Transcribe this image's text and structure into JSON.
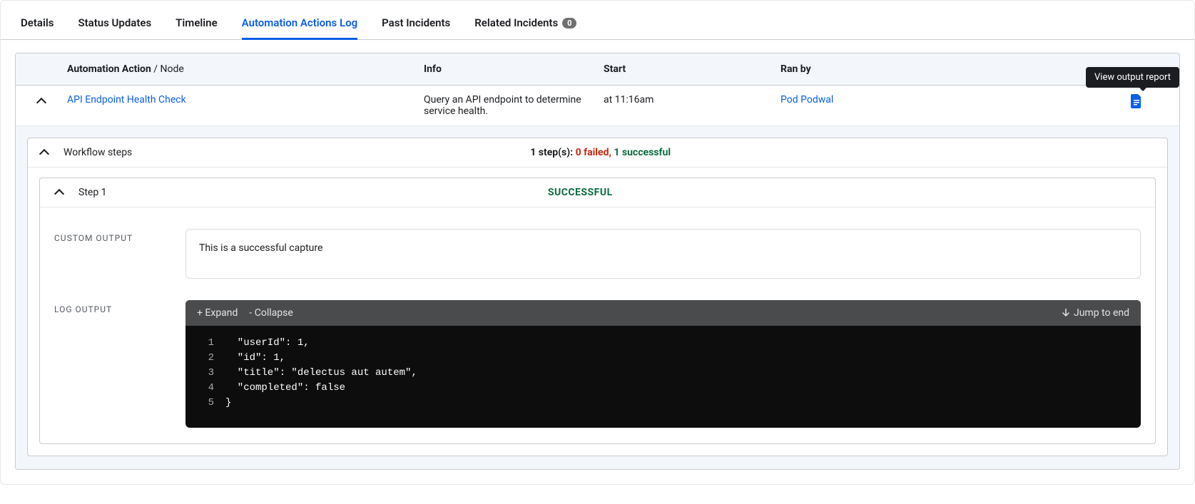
{
  "tabs": {
    "details": "Details",
    "status_updates": "Status Updates",
    "timeline": "Timeline",
    "automation_log": "Automation Actions Log",
    "past_incidents": "Past Incidents",
    "related_incidents": "Related Incidents",
    "related_incidents_count": "0"
  },
  "columns": {
    "action_main": "Automation Action",
    "action_sep": " / ",
    "action_sub": "Node",
    "info": "Info",
    "start": "Start",
    "ran_by": "Ran by"
  },
  "row": {
    "action_name": "API Endpoint Health Check",
    "info": "Query an API endpoint to determine service health.",
    "start": "at 11:16am",
    "ran_by": "Pod Podwal",
    "tooltip": "View output report"
  },
  "workflow": {
    "title": "Workflow steps",
    "summary_count": "1 step(s):",
    "failed_n": "0",
    "failed_label": " failed,",
    "success_n": "1",
    "success_label": " successful"
  },
  "step": {
    "title": "Step 1",
    "status": "SUCCESSFUL",
    "custom_output_label": "CUSTOM OUTPUT",
    "custom_output_value": "This is a successful capture",
    "log_output_label": "LOG OUTPUT",
    "toolbar_expand": "+ Expand",
    "toolbar_collapse": "- Collapse",
    "toolbar_jump": "Jump to end",
    "log_lines": [
      "  \"userId\": 1,",
      "  \"id\": 1,",
      "  \"title\": \"delectus aut autem\",",
      "  \"completed\": false",
      "}"
    ]
  }
}
